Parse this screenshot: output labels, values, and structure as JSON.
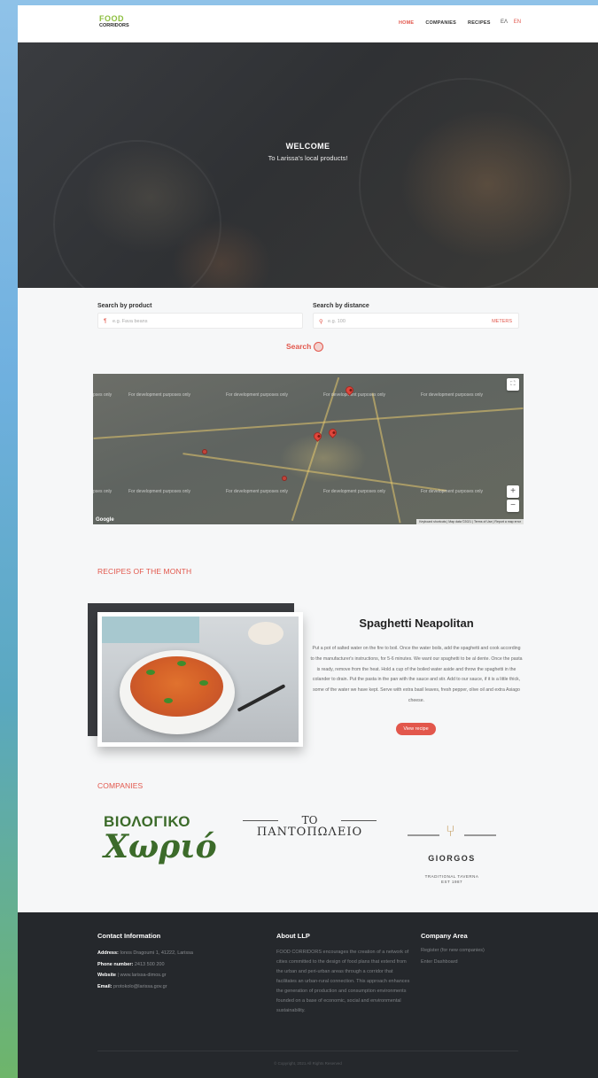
{
  "nav": {
    "logo_line1": "FOOD",
    "logo_line2": "CORRIDORS",
    "links": [
      "HOME",
      "COMPANIES",
      "RECIPES"
    ],
    "lang_el": "ΕΛ",
    "lang_en": "EN"
  },
  "hero": {
    "title": "WELCOME",
    "subtitle": "To Larissa's local products!"
  },
  "search": {
    "product_label": "Search by product",
    "product_placeholder": "e.g. Fava beans",
    "distance_label": "Search by distance",
    "distance_placeholder": "e.g. 100",
    "distance_unit": "METERS",
    "button": "Search"
  },
  "map": {
    "dev_text": "For development purposes only",
    "dev_text_short": "pses only",
    "google": "Google",
    "footer": "Keyboard shortcuts  |  Map data ©2021  |  Terms of Use  |  Report a map error",
    "zoom_in": "+",
    "zoom_out": "−"
  },
  "recipes": {
    "section_title": "RECIPES OF THE MONTH",
    "title": "Spaghetti Neapolitan",
    "description": "Put a pot of salted water on the fire to boil. Once the water boils, add the spaghetti and cook according to the manufacturer's instructions, for 5-6 minutes. We want our spaghetti to be al dente. Once the pasta is ready, remove from the heat. Hold a cup of the boiled water aside and throw the spaghetti in the colander to drain. Put the pasta in the pan with the sauce and stir. Add to our sauce, if it is a little thick, some of the water we have kept. Serve with extra basil leaves, fresh pepper, olive oil and extra Asiago cheese.",
    "button": "View recipe"
  },
  "companies": {
    "section_title": "COMPANIES",
    "c1_line1": "ΒΙΟΛΟΓΙΚΟ",
    "c1_line2": "Χωριό",
    "c2_line1": "ΤΟ",
    "c2_line2": "ΠΑΝΤΟΠΩΛΕΙΟ",
    "c3_name": "GIORGOS",
    "c3_tag1": "TRADITIONAL TAVERNA",
    "c3_tag2": "EST 1987"
  },
  "footer": {
    "contact_title": "Contact Information",
    "address_label": "Address:",
    "address": "Ionos Dragoumi 1, 41222, Larissa",
    "phone_label": "Phone number:",
    "phone": "2413 500 200",
    "website_label": "Website",
    "website": "www.larissa-dimos.gr",
    "email_label": "Email:",
    "email": "protokolo@larissa.gov.gr",
    "about_title": "About LLP",
    "about_text": "FOOD CORRIDORS encourages the creation of a network of cities committed to the design of food plans that extend from the urban and peri-urban areas through a corridor that facilitates an urban-rural connection. This approach enhances the generation of production and consumption environments founded on a base of economic, social and environmental sustainability.",
    "company_title": "Company Area",
    "register": "Register (for new companies)",
    "dashboard": "Enter Dashboard",
    "copyright": "© Copyright, 2021 All Rights Reserved"
  },
  "colors": {
    "accent": "#e2574c",
    "footer_bg": "#25282c",
    "logo_green": "#8dbf3f"
  }
}
